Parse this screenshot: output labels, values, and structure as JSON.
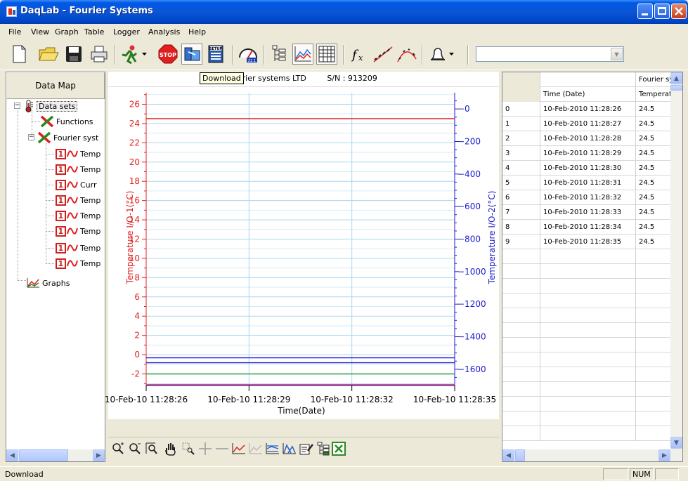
{
  "window": {
    "title": "DaqLab - Fourier Systems"
  },
  "menu": [
    "File",
    "View",
    "Graph",
    "Table",
    "Logger",
    "Analysis",
    "Help"
  ],
  "toolbar": {
    "tooltip": "Download",
    "icons": [
      "new-icon",
      "open-folder-icon",
      "save-icon",
      "print-icon",
      "run-icon",
      "dropdown-arrow",
      "stop-icon",
      "download-icon",
      "setup-icon",
      "meter-icon",
      "data-map-icon",
      "graph-icon",
      "table-icon",
      "function-icon",
      "trend-line-icon",
      "curve-fit-icon",
      "alarm-bell-icon",
      "dropdown-arrow"
    ],
    "combo_value": ""
  },
  "left_panel": {
    "datamap_label": "Data Map",
    "tree": {
      "data_sets": "Data sets",
      "functions": "Functions",
      "logger": "Fourier syst",
      "sensors": [
        "Temp",
        "Temp",
        "Curr",
        "Temp",
        "Temp",
        "Temp",
        "Temp",
        "Temp"
      ],
      "graphs": "Graphs"
    }
  },
  "chart": {
    "header_text": "Fourier systems LTD",
    "serial": "S/N : 913209",
    "colors": {
      "left_axis": "#e02020",
      "right_axis": "#1c1cd0",
      "green": "#20a040",
      "magenta": "#d040d0"
    }
  },
  "chart_data": {
    "type": "line",
    "xlabel": "Time(Date)",
    "x_ticks": [
      "10-Feb-10 11:28:26",
      "10-Feb-10 11:28:29",
      "10-Feb-10 11:28:32",
      "10-Feb-10 11:28:35"
    ],
    "y_left": {
      "label": "Temperature I/O-1(°C)",
      "ticks": [
        26,
        24,
        22,
        20,
        18,
        16,
        14,
        12,
        10,
        8,
        6,
        4,
        2,
        0,
        -2
      ],
      "range": [
        -3.2,
        27.2
      ]
    },
    "y_right": {
      "label": "Temperature I/O-2(°C)",
      "ticks": [
        0,
        -200,
        -400,
        -600,
        -800,
        -1000,
        -1200,
        -1400,
        -1600
      ],
      "range": [
        -1700,
        100
      ]
    },
    "series": [
      {
        "axis": "left",
        "color": "#e02020",
        "values": [
          24.5,
          24.5,
          24.5,
          24.5,
          24.5,
          24.5,
          24.5,
          24.5,
          24.5,
          24.5
        ]
      },
      {
        "axis": "right",
        "color": "#1c1cd0",
        "values": [
          -1530,
          -1530,
          -1530,
          -1530,
          -1530,
          -1530,
          -1530,
          -1530,
          -1530,
          -1530
        ]
      },
      {
        "axis": "right",
        "color": "#1c1cd0",
        "values": [
          -1560,
          -1560,
          -1560,
          -1560,
          -1560,
          -1560,
          -1560,
          -1560,
          -1560,
          -1560
        ]
      },
      {
        "axis": "left",
        "color": "#20a040",
        "values": [
          -2,
          -2,
          -2,
          -2,
          -2,
          -2,
          -2,
          -2,
          -2,
          -2
        ]
      },
      {
        "axis": "left",
        "color": "#d040d0",
        "values": [
          -3.1,
          -3.1,
          -3.1,
          -3.1,
          -3.1,
          -3.1,
          -3.1,
          -3.1,
          -3.1,
          -3.1
        ]
      }
    ],
    "grid": true
  },
  "chart_tools": [
    "zoom-in-icon",
    "zoom-out-icon",
    "zoom-fit-icon",
    "pan-hand-icon",
    "zoom-area-icon",
    "cursor-add-icon",
    "cursor-remove-icon",
    "line-graph-icon",
    "line-graph-gray-icon",
    "multi-line-icon",
    "bar-area-icon",
    "properties-icon",
    "data-map-icon",
    "excel-export-icon"
  ],
  "table": {
    "group_header": "Fourier sys",
    "columns": [
      "Time (Date)",
      "Temperatu"
    ],
    "rows": [
      {
        "i": "0",
        "time": "10-Feb-2010 11:28:26",
        "temp": "24.5"
      },
      {
        "i": "1",
        "time": "10-Feb-2010 11:28:27",
        "temp": "24.5"
      },
      {
        "i": "2",
        "time": "10-Feb-2010 11:28:28",
        "temp": "24.5"
      },
      {
        "i": "3",
        "time": "10-Feb-2010 11:28:29",
        "temp": "24.5"
      },
      {
        "i": "4",
        "time": "10-Feb-2010 11:28:30",
        "temp": "24.5"
      },
      {
        "i": "5",
        "time": "10-Feb-2010 11:28:31",
        "temp": "24.5"
      },
      {
        "i": "6",
        "time": "10-Feb-2010 11:28:32",
        "temp": "24.5"
      },
      {
        "i": "7",
        "time": "10-Feb-2010 11:28:33",
        "temp": "24.5"
      },
      {
        "i": "8",
        "time": "10-Feb-2010 11:28:34",
        "temp": "24.5"
      },
      {
        "i": "9",
        "time": "10-Feb-2010 11:28:35",
        "temp": "24.5"
      }
    ]
  },
  "status": {
    "text": "Download",
    "num": "NUM"
  }
}
